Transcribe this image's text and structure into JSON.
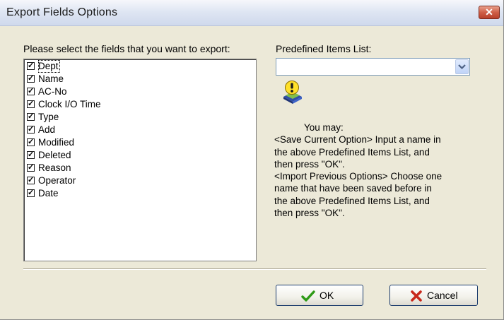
{
  "dialog": {
    "title": "Export Fields Options",
    "close_symbol": "✕"
  },
  "fields": {
    "prompt": "Please select the fields that you want to export:",
    "items": [
      {
        "label": "Dept",
        "checked": true
      },
      {
        "label": "Name",
        "checked": true
      },
      {
        "label": "AC-No",
        "checked": true
      },
      {
        "label": "Clock I/O Time",
        "checked": true
      },
      {
        "label": "Type",
        "checked": true
      },
      {
        "label": "Add",
        "checked": true
      },
      {
        "label": "Modified",
        "checked": true
      },
      {
        "label": "Deleted",
        "checked": true
      },
      {
        "label": "Reason",
        "checked": true
      },
      {
        "label": "Operator",
        "checked": true
      },
      {
        "label": "Date",
        "checked": true
      }
    ],
    "check_glyph": "✓"
  },
  "predefined": {
    "label": "Predefined Items List:",
    "value": "",
    "icon": "info-warning-icon"
  },
  "info": {
    "lines": [
      "You may:",
      "<Save Current Option> Input a name in",
      "the above Predefined Items List, and",
      "then press \"OK\".",
      "<Import Previous Options> Choose one",
      "name that have been saved before in",
      "the above Predefined Items List, and",
      "then press \"OK\"."
    ]
  },
  "buttons": {
    "ok_label": "OK",
    "cancel_label": "Cancel"
  },
  "colors": {
    "dialog_bg": "#ece9d8",
    "ok_check": "#2e9a16",
    "cancel_x": "#c8281b",
    "close_button": "#c8563f"
  }
}
